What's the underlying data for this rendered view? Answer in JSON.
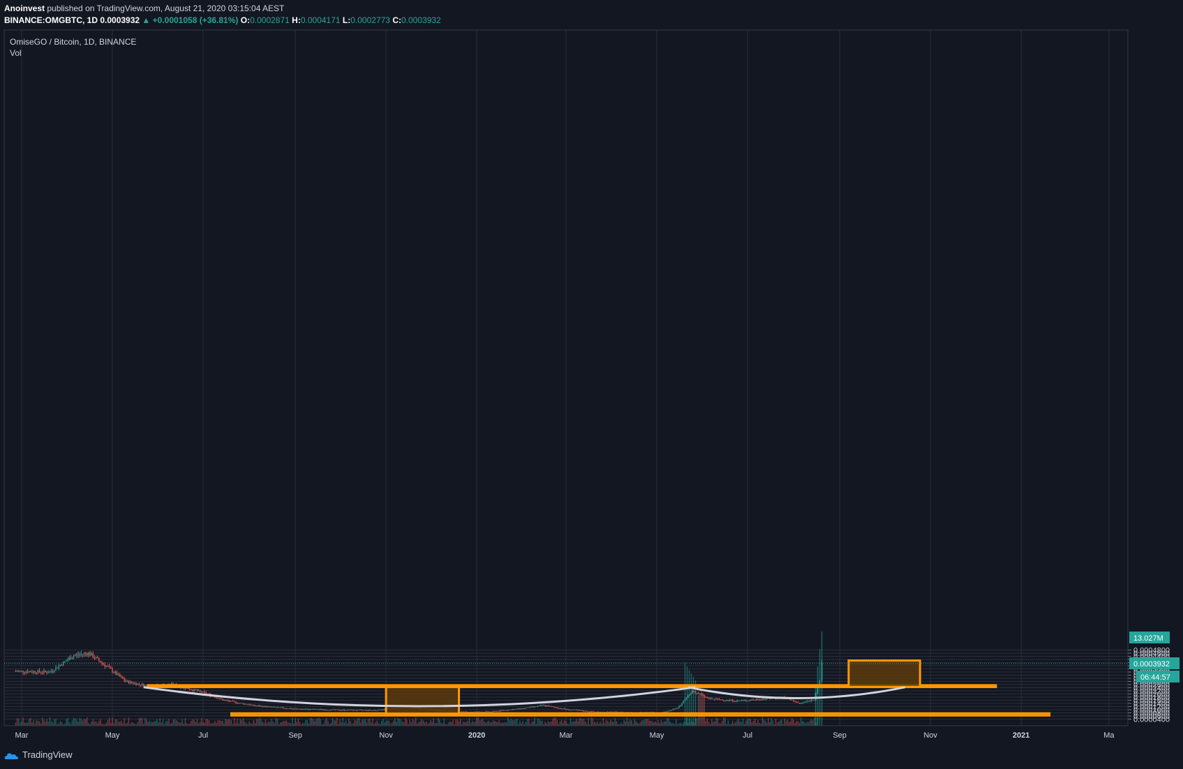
{
  "header": {
    "author": "Anoinvest",
    "published_text": "published on TradingView.com, August 21, 2020 03:15:04 AEST",
    "symbol": "BINANCE:OMGBTC, 1D",
    "last": "0.0003932",
    "change": "▲ +0.0001058 (+36.81%)",
    "o_label": "O:",
    "o_value": "0.0002871",
    "h_label": "H:",
    "h_value": "0.0004171",
    "l_label": "L:",
    "l_value": "0.0002773",
    "c_label": "C:",
    "c_value": "0.0003932"
  },
  "legend": {
    "title": "OmiseGO / Bitcoin, 1D, BINANCE",
    "vol": "Vol"
  },
  "footer": {
    "logo_text": "TradingView"
  },
  "colors": {
    "background": "#131722",
    "grid": "#2a2e39",
    "up": "#26a69a",
    "down": "#ef5350",
    "box_border": "#ff9800",
    "box_fill": "#5c3a0d",
    "curve": "#d1d4dc",
    "price_tag": "#26a69a"
  },
  "chart_data": {
    "type": "candlestick",
    "title": "OmiseGO / Bitcoin, 1D, BINANCE",
    "x_tick_labels": [
      "Mar",
      "May",
      "Jul",
      "Sep",
      "Nov",
      "2020",
      "Mar",
      "May",
      "Jul",
      "Sep",
      "Nov",
      "2021",
      "Ma"
    ],
    "y_tick_labels": [
      "0.0004800",
      "0.0004600",
      "0.0004400",
      "0.0004200",
      "0.0004000",
      "0.0003800",
      "0.0003600",
      "0.0003400",
      "0.0003200",
      "0.0003000",
      "0.0002800",
      "0.0002600",
      "0.0002400",
      "0.0002200",
      "0.0002000",
      "0.0001800",
      "0.0001600",
      "0.0001400",
      "0.0001200",
      "0.0001000",
      "0.0000800",
      "0.0000600",
      "0.0000400"
    ],
    "ylim": [
      3.8e-05,
      0.000484
    ],
    "price_points": [
      {
        "date": "2019-02-25",
        "close": 0.000345
      },
      {
        "date": "2019-03-20",
        "close": 0.00034
      },
      {
        "date": "2019-04-05",
        "close": 0.000445
      },
      {
        "date": "2019-04-15",
        "close": 0.00046
      },
      {
        "date": "2019-04-28",
        "close": 0.00037
      },
      {
        "date": "2019-05-10",
        "close": 0.00028
      },
      {
        "date": "2019-05-25",
        "close": 0.00025
      },
      {
        "date": "2019-06-10",
        "close": 0.00026
      },
      {
        "date": "2019-07-01",
        "close": 0.00021
      },
      {
        "date": "2019-07-15",
        "close": 0.00016
      },
      {
        "date": "2019-08-05",
        "close": 0.000125
      },
      {
        "date": "2019-09-01",
        "close": 0.000105
      },
      {
        "date": "2019-10-01",
        "close": 9.8e-05
      },
      {
        "date": "2019-10-25",
        "close": 9.6e-05
      },
      {
        "date": "2019-11-15",
        "close": 0.000118
      },
      {
        "date": "2019-12-01",
        "close": 0.0001
      },
      {
        "date": "2019-12-20",
        "close": 8.6e-05
      },
      {
        "date": "2020-01-10",
        "close": 8.7e-05
      },
      {
        "date": "2020-02-01",
        "close": 0.000108
      },
      {
        "date": "2020-02-15",
        "close": 0.000128
      },
      {
        "date": "2020-03-01",
        "close": 0.000102
      },
      {
        "date": "2020-03-20",
        "close": 8.6e-05
      },
      {
        "date": "2020-04-10",
        "close": 8.4e-05
      },
      {
        "date": "2020-05-05",
        "close": 8.2e-05
      },
      {
        "date": "2020-05-15",
        "close": 0.00011
      },
      {
        "date": "2020-05-25",
        "close": 0.00022
      },
      {
        "date": "2020-06-05",
        "close": 0.00017
      },
      {
        "date": "2020-06-25",
        "close": 0.000155
      },
      {
        "date": "2020-07-15",
        "close": 0.000172
      },
      {
        "date": "2020-07-25",
        "close": 0.00018
      },
      {
        "date": "2020-08-05",
        "close": 0.00014
      },
      {
        "date": "2020-08-15",
        "close": 0.000165
      },
      {
        "date": "2020-08-20",
        "close": 0.0003932
      }
    ],
    "current_price_label": "0.0003932",
    "countdown_label": "06:44:57",
    "volume_label": "13.027M",
    "annotations": [
      {
        "kind": "box",
        "name": "resistance-zone",
        "from": "2019-05-25",
        "to": "2020-12-15",
        "low": 0.000244,
        "high": 0.000256
      },
      {
        "kind": "box",
        "name": "support-zone",
        "from": "2019-07-20",
        "to": "2021-01-20",
        "low": 6.3e-05,
        "high": 7.7e-05
      },
      {
        "kind": "box",
        "name": "cup-depth-box",
        "from": "2019-11-01",
        "to": "2019-12-20",
        "low": 7.5e-05,
        "high": 0.000244
      },
      {
        "kind": "box",
        "name": "target-box",
        "from": "2020-09-07",
        "to": "2020-10-25",
        "low": 0.000245,
        "high": 0.000413
      },
      {
        "kind": "curve",
        "name": "cup-curve",
        "shape": "U"
      },
      {
        "kind": "curve",
        "name": "handle-curve",
        "shape": "U"
      }
    ]
  }
}
